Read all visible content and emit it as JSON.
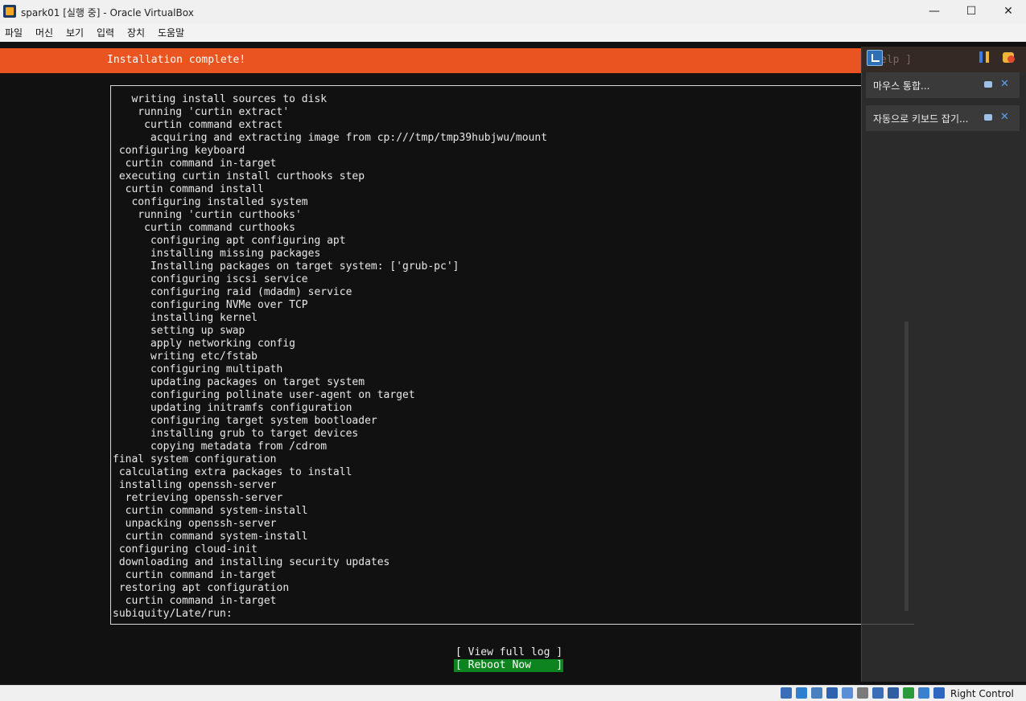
{
  "window": {
    "title": "spark01 [실행 중] - Oracle VirtualBox",
    "minimize": "—",
    "maximize": "☐",
    "close": "✕"
  },
  "menu": [
    "파일",
    "머신",
    "보기",
    "입력",
    "장치",
    "도움말"
  ],
  "installer": {
    "title": "Installation complete!",
    "help_ghost": "elp ]",
    "log": [
      "   writing install sources to disk",
      "    running 'curtin extract'",
      "     curtin command extract",
      "      acquiring and extracting image from cp:///tmp/tmp39hubjwu/mount",
      " configuring keyboard",
      "  curtin command in-target",
      " executing curtin install curthooks step",
      "  curtin command install",
      "   configuring installed system",
      "    running 'curtin curthooks'",
      "     curtin command curthooks",
      "      configuring apt configuring apt",
      "      installing missing packages",
      "      Installing packages on target system: ['grub-pc']",
      "      configuring iscsi service",
      "      configuring raid (mdadm) service",
      "      configuring NVMe over TCP",
      "      installing kernel",
      "      setting up swap",
      "      apply networking config",
      "      writing etc/fstab",
      "      configuring multipath",
      "      updating packages on target system",
      "      configuring pollinate user-agent on target",
      "      updating initramfs configuration",
      "      configuring target system bootloader",
      "      installing grub to target devices",
      "      copying metadata from /cdrom",
      "final system configuration",
      " calculating extra packages to install",
      " installing openssh-server",
      "  retrieving openssh-server",
      "  curtin command system-install",
      "  unpacking openssh-server",
      "  curtin command system-install",
      " configuring cloud-init",
      " downloading and installing security updates",
      "  curtin command in-target",
      " restoring apt configuration",
      "  curtin command in-target",
      "subiquity/Late/run:"
    ],
    "view_log_button": "[ View full log ]",
    "reboot_button": "[ Reboot Now    ]"
  },
  "notifications": [
    {
      "text": "마우스 통합..."
    },
    {
      "text": "자동으로 키보드 잡기..."
    }
  ],
  "colors": {
    "header": "#e95420",
    "reboot_highlight": "#0e8420",
    "terminal_bg": "#111111"
  },
  "status": {
    "host_key": "Right Control",
    "icons": [
      "hard-disk-icon",
      "optical-drive-icon",
      "audio-icon",
      "network-icon",
      "usb-icon",
      "shared-folders-icon",
      "display-icon",
      "recording-icon",
      "cpu-icon",
      "mouse-integration-icon",
      "keyboard-capture-icon"
    ]
  }
}
